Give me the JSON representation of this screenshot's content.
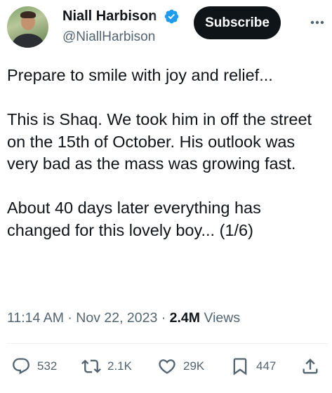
{
  "author": {
    "display_name": "Niall Harbison",
    "handle": "@NiallHarbison",
    "verified": true
  },
  "header": {
    "subscribe_label": "Subscribe"
  },
  "tweet": {
    "paragraphs": [
      "Prepare to smile with joy and relief...",
      "This is Shaq. We took him in off the street on the 15th of October. His outlook was very bad as the mass was growing fast.",
      "About 40 days later everything has changed for this lovely boy... (1/6)"
    ]
  },
  "meta": {
    "time": "11:14 AM",
    "date": "Nov 22, 2023",
    "separator": "·",
    "views_count": "2.4M",
    "views_label": "Views"
  },
  "actions": {
    "replies": "532",
    "reposts": "2.1K",
    "likes": "29K",
    "bookmarks": "447"
  },
  "colors": {
    "text_primary": "#0f1419",
    "text_secondary": "#536471",
    "verified_blue": "#1d9bf0",
    "subscribe_bg": "#0f1419"
  }
}
